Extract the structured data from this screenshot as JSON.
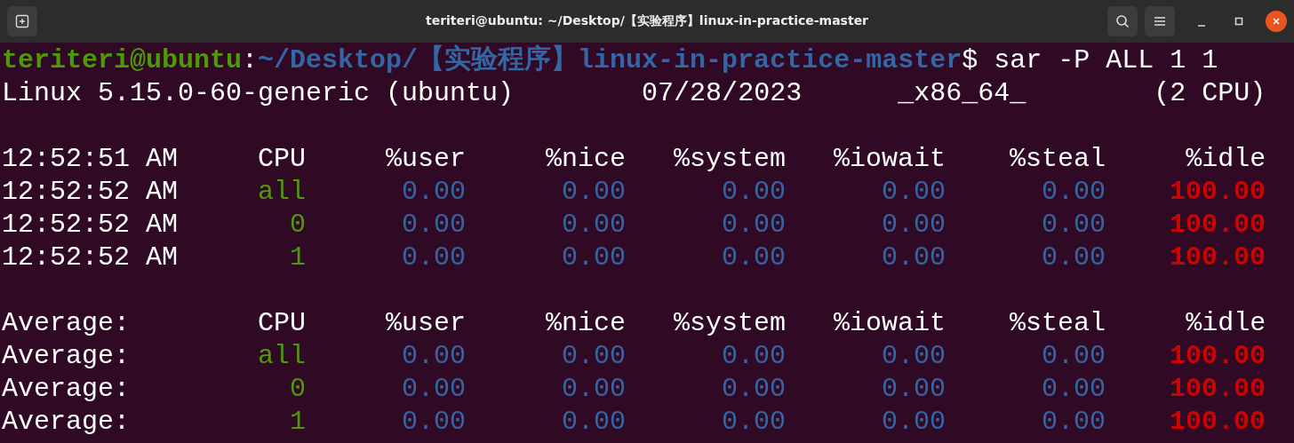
{
  "window": {
    "title": "teriteri@ubuntu: ~/Desktop/【实验程序】linux-in-practice-master"
  },
  "prompt": {
    "user_host": "teriteri@ubuntu",
    "separator": ":",
    "path": "~/Desktop/【实验程序】linux-in-practice-master",
    "symbol": "$",
    "command": "sar -P ALL 1 1"
  },
  "system_line": {
    "kernel": "Linux 5.15.0-60-generic (ubuntu)",
    "date": "07/28/2023",
    "arch": "_x86_64_",
    "cpus": "(2 CPU)"
  },
  "blocks": [
    {
      "header": [
        "12:52:51 AM",
        "CPU",
        "%user",
        "%nice",
        "%system",
        "%iowait",
        "%steal",
        "%idle"
      ],
      "rows": [
        {
          "label": "12:52:52 AM",
          "cpu": "all",
          "values": [
            "0.00",
            "0.00",
            "0.00",
            "0.00",
            "0.00"
          ],
          "idle": "100.00"
        },
        {
          "label": "12:52:52 AM",
          "cpu": "0",
          "values": [
            "0.00",
            "0.00",
            "0.00",
            "0.00",
            "0.00"
          ],
          "idle": "100.00"
        },
        {
          "label": "12:52:52 AM",
          "cpu": "1",
          "values": [
            "0.00",
            "0.00",
            "0.00",
            "0.00",
            "0.00"
          ],
          "idle": "100.00"
        }
      ]
    },
    {
      "header": [
        "Average:",
        "CPU",
        "%user",
        "%nice",
        "%system",
        "%iowait",
        "%steal",
        "%idle"
      ],
      "rows": [
        {
          "label": "Average:",
          "cpu": "all",
          "values": [
            "0.00",
            "0.00",
            "0.00",
            "0.00",
            "0.00"
          ],
          "idle": "100.00"
        },
        {
          "label": "Average:",
          "cpu": "0",
          "values": [
            "0.00",
            "0.00",
            "0.00",
            "0.00",
            "0.00"
          ],
          "idle": "100.00"
        },
        {
          "label": "Average:",
          "cpu": "1",
          "values": [
            "0.00",
            "0.00",
            "0.00",
            "0.00",
            "0.00"
          ],
          "idle": "100.00"
        }
      ]
    }
  ]
}
